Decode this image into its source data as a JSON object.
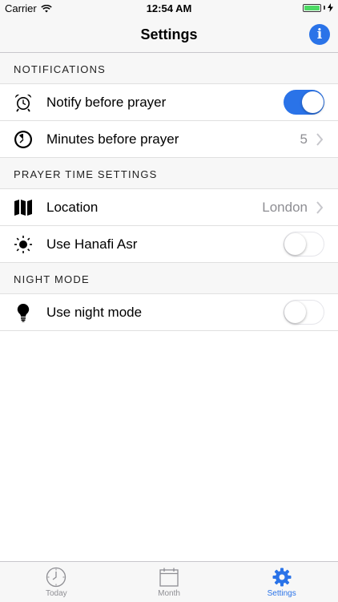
{
  "status_bar": {
    "carrier": "Carrier",
    "time": "12:54 AM"
  },
  "nav": {
    "title": "Settings",
    "info_label": "i"
  },
  "sections": {
    "notifications": {
      "header": "NOTIFICATIONS",
      "notify": {
        "label": "Notify before prayer",
        "enabled": true
      },
      "minutes": {
        "label": "Minutes before prayer",
        "value": "5"
      }
    },
    "prayer": {
      "header": "PRAYER TIME SETTINGS",
      "location": {
        "label": "Location",
        "value": "London"
      },
      "hanafi": {
        "label": "Use Hanafi Asr",
        "enabled": false
      }
    },
    "night": {
      "header": "NIGHT MODE",
      "night_mode": {
        "label": "Use night mode",
        "enabled": false
      }
    }
  },
  "tabs": [
    {
      "label": "Today",
      "icon": "clock-icon",
      "active": false
    },
    {
      "label": "Month",
      "icon": "calendar-icon",
      "active": false
    },
    {
      "label": "Settings",
      "icon": "gear-icon",
      "active": true
    }
  ],
  "colors": {
    "accent": "#2a73e8",
    "battery": "#4cd964",
    "secondary_text": "#8e8e93"
  }
}
